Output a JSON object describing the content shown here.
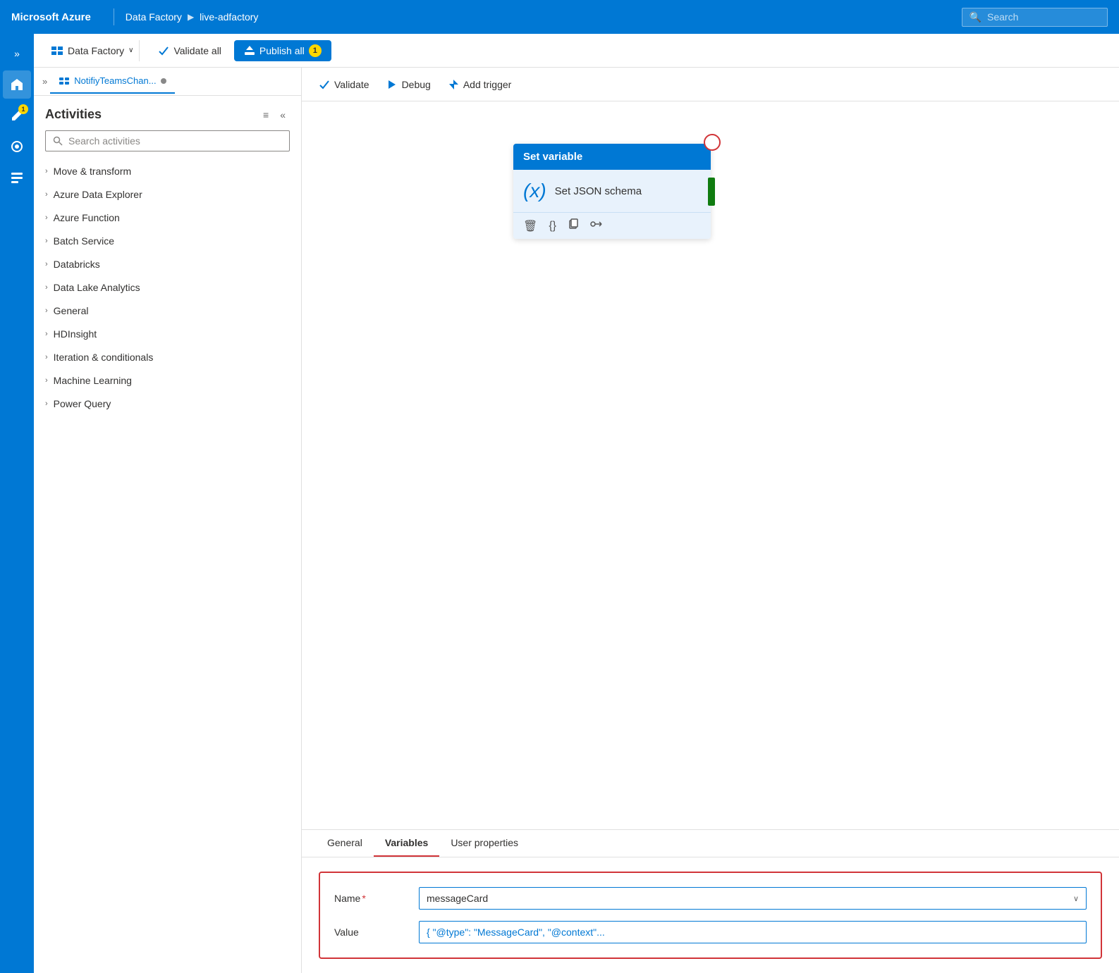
{
  "topbar": {
    "brand": "Microsoft Azure",
    "breadcrumb": [
      "Data Factory",
      "live-adfactory"
    ],
    "search_placeholder": "Search"
  },
  "toolbar": {
    "df_label": "Data Factory",
    "validate_label": "Validate all",
    "publish_label": "Publish all",
    "publish_badge": "1"
  },
  "tab": {
    "label": "NotifiyTeamsChan...",
    "dot_visible": true
  },
  "activities": {
    "title": "Activities",
    "search_placeholder": "Search activities",
    "categories": [
      {
        "label": "Move & transform"
      },
      {
        "label": "Azure Data Explorer"
      },
      {
        "label": "Azure Function"
      },
      {
        "label": "Batch Service"
      },
      {
        "label": "Databricks"
      },
      {
        "label": "Data Lake Analytics"
      },
      {
        "label": "General"
      },
      {
        "label": "HDInsight"
      },
      {
        "label": "Iteration & conditionals"
      },
      {
        "label": "Machine Learning"
      },
      {
        "label": "Power Query"
      }
    ]
  },
  "canvas_toolbar": {
    "validate": "Validate",
    "debug": "Debug",
    "add_trigger": "Add trigger"
  },
  "activity_card": {
    "header": "Set variable",
    "name": "Set JSON schema",
    "icon_text": "(x)"
  },
  "bottom_tabs": {
    "general": "General",
    "variables": "Variables",
    "user_properties": "User properties"
  },
  "form": {
    "name_label": "Name",
    "name_required": "*",
    "name_value": "messageCard",
    "value_label": "Value",
    "value_value": "{ \"@type\": \"MessageCard\", \"@context\"..."
  },
  "icons": {
    "home": "⌂",
    "edit": "✏",
    "settings": "⚙",
    "briefcase": "💼",
    "search": "🔍",
    "validate": "✓",
    "debug": "▷",
    "trigger": "⚡",
    "expand": "»",
    "collapse": "«",
    "chevron_down": "∨",
    "chevron_right": "›",
    "trash": "🗑",
    "code": "{}",
    "copy": "⎘",
    "arrow": "⊕→"
  }
}
